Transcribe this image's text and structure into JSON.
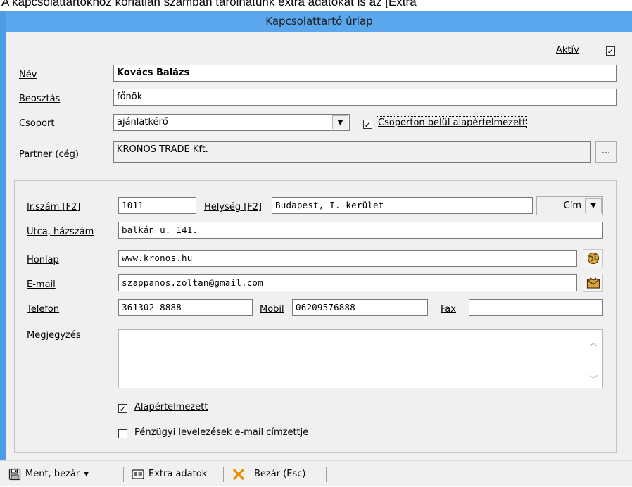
{
  "caption": "A kapcsolattartókhoz korlátlan számban tárolhatunk extra adatokat is az [Extra",
  "window": {
    "title": "Kapcsolattartó úrlap"
  },
  "form": {
    "active_label": "Aktív",
    "active_checked": true,
    "name_label": "Név",
    "name_value": "Kovács Balázs",
    "position_label": "Beosztás",
    "position_value": "főnök",
    "group_label": "Csoport",
    "group_value": "ajánlatkérő",
    "group_default_label": "Csoporton belül alapértelmezett",
    "group_default_checked": true,
    "partner_label": "Partner (cég)",
    "partner_value": "KRONOS TRADE Kft.",
    "partner_button": "..."
  },
  "address": {
    "zip_label": "Ir.szám [F2]",
    "zip_value": "1011",
    "city_label": "Helység [F2]",
    "city_value": "Budapest, I. kerület",
    "addr_button": "Cím",
    "street_label": "Utca, házszám",
    "street_value": "balkán u. 141.",
    "web_label": "Honlap",
    "web_value": "www.kronos.hu",
    "email_label": "E-mail",
    "email_value": "szappanos.zoltan@gmail.com",
    "phone_label": "Telefon",
    "phone_value": "361302-8888",
    "mobile_label": "Mobil",
    "mobile_value": "06209576888",
    "fax_label": "Fax",
    "fax_value": "",
    "note_label": "Megjegyzés",
    "note_value": "",
    "default_label": "Alapértelmezett",
    "default_checked": true,
    "finance_label": "Pénzügyi levelezések e-mail címzettje",
    "finance_checked": false
  },
  "toolbar": {
    "save_label": "Ment, bezár",
    "extra_label": "Extra adatok",
    "close_label": "Bezár (Esc)"
  },
  "colors": {
    "title_bar": "#5aa7ee",
    "window_edge": "#4d9ce6",
    "form_bg": "#f0f0f0",
    "close_icon": "#f08c00"
  },
  "icons": [
    "save-disk-icon",
    "chevron-down-icon",
    "id-card-icon",
    "close-x-icon",
    "globe-icon",
    "envelope-icon"
  ]
}
